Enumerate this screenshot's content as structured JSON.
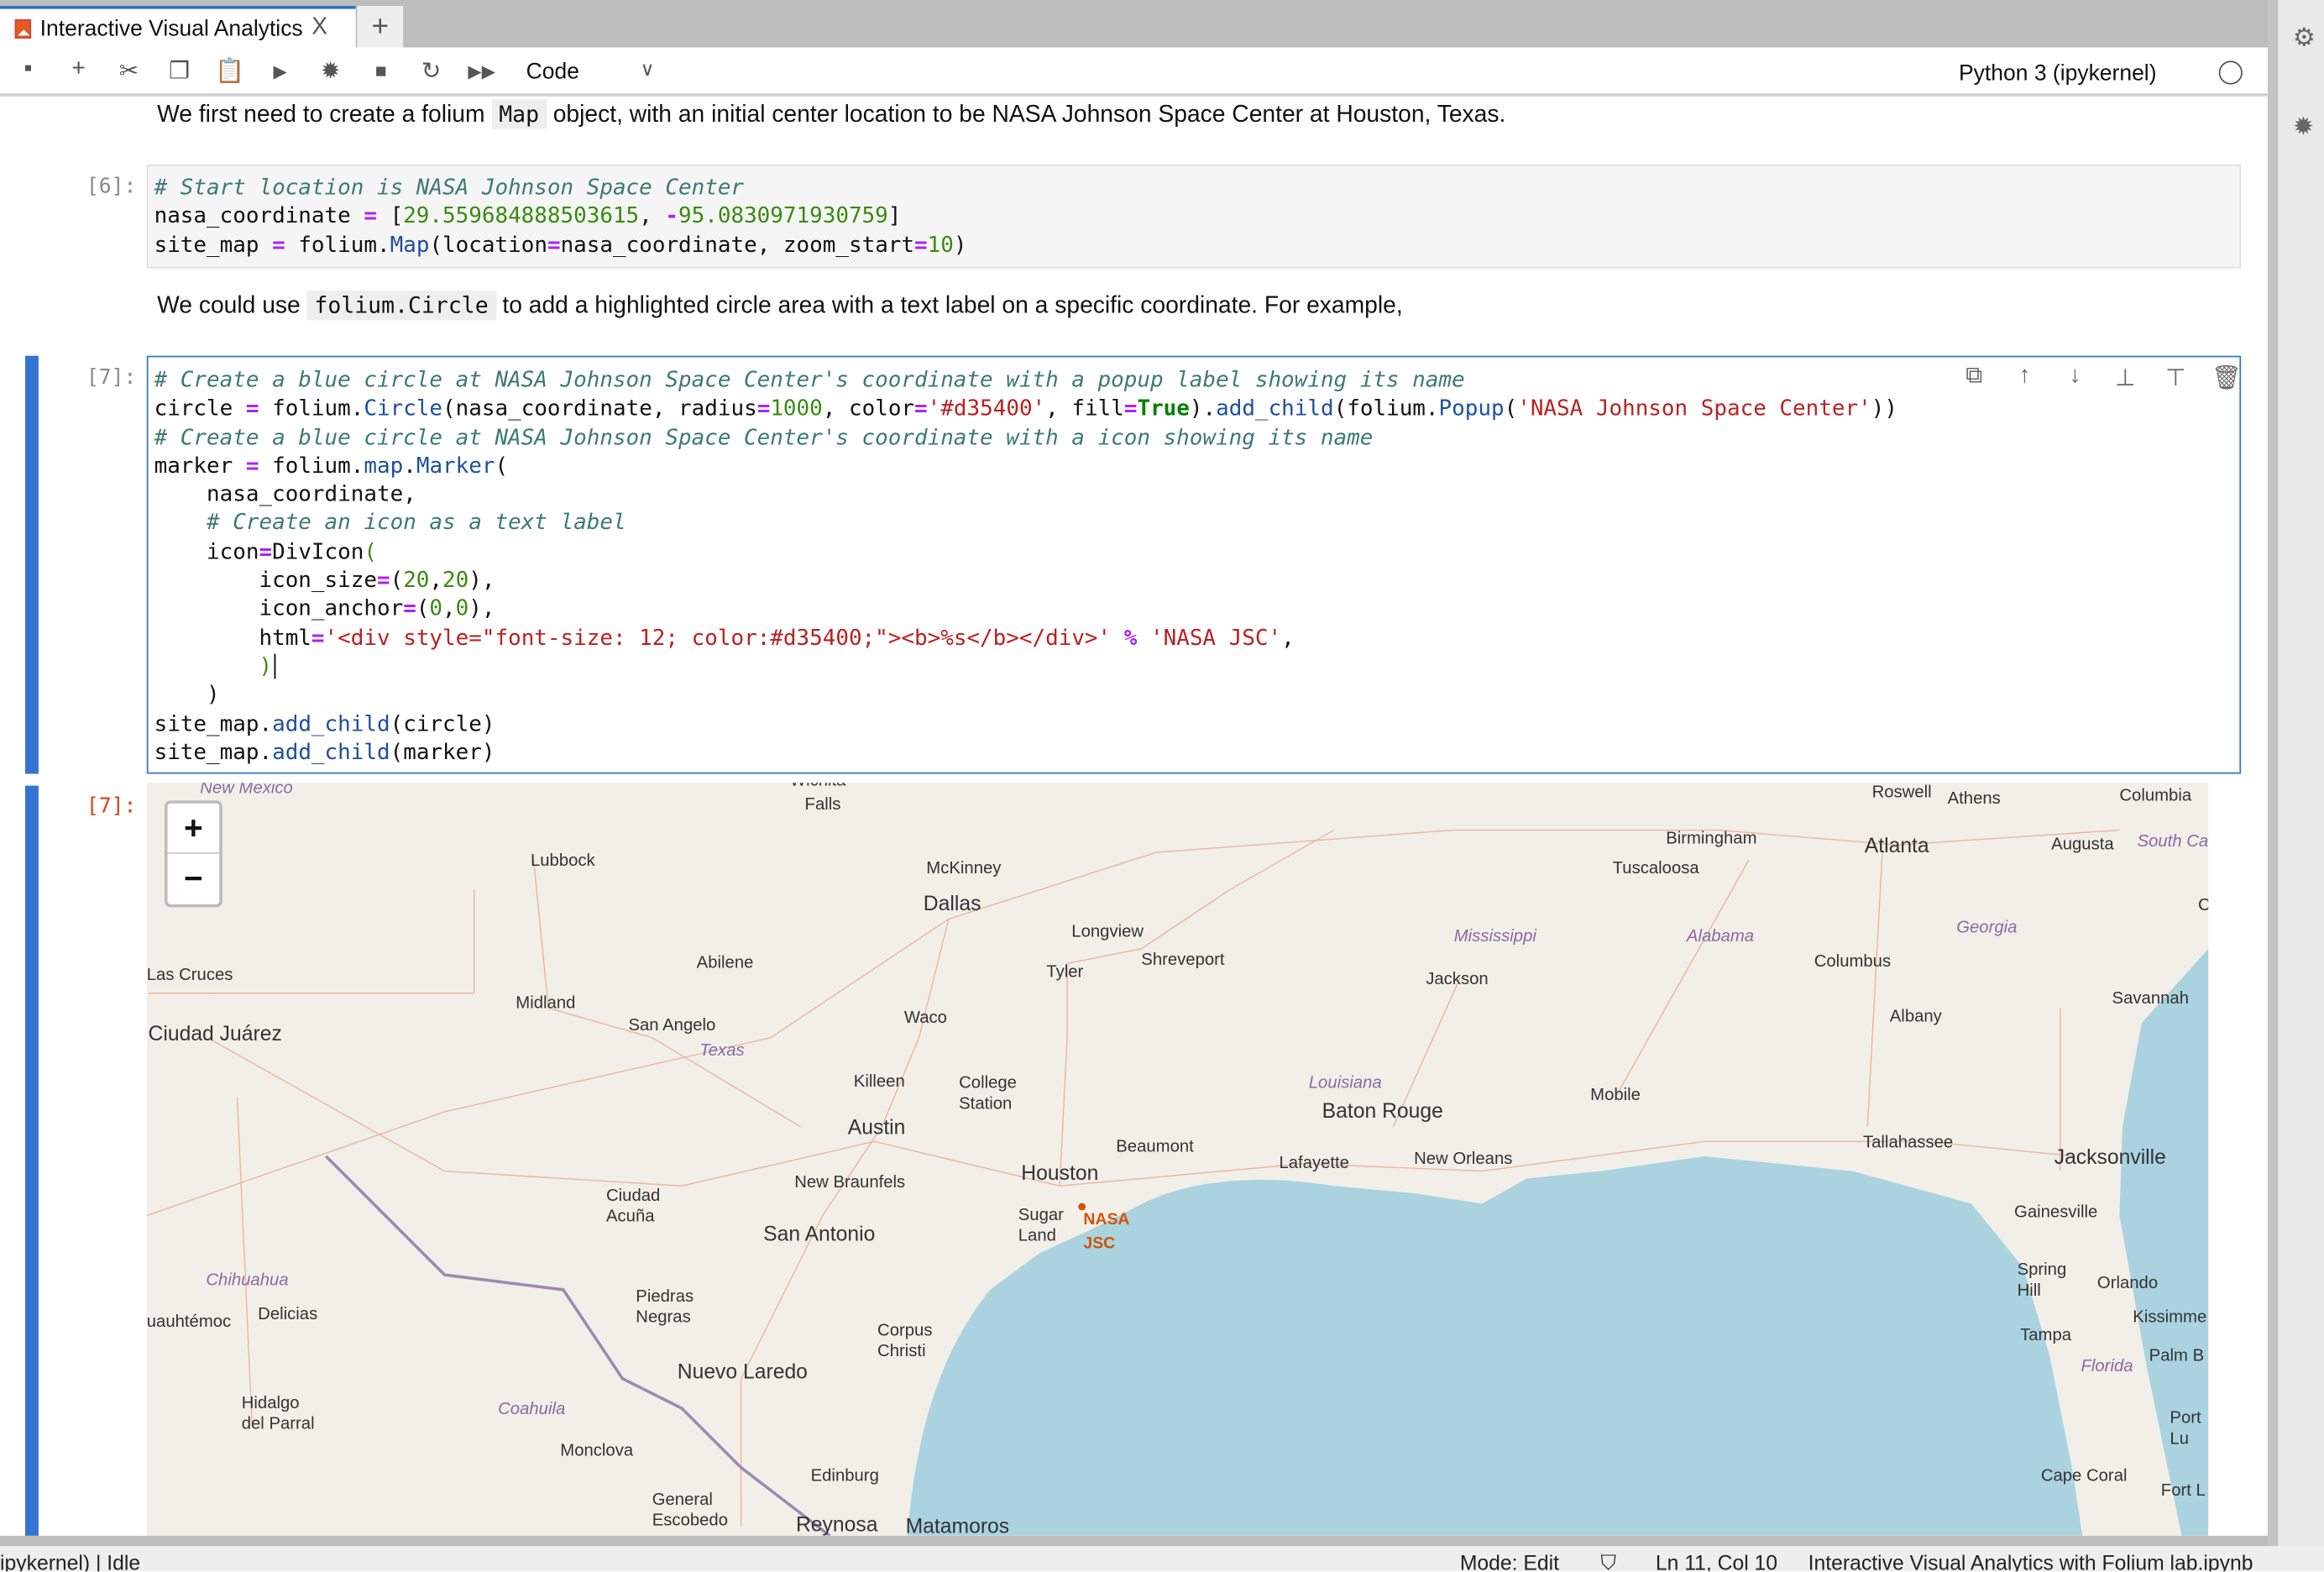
{
  "tab": {
    "title": "Interactive Visual Analytics",
    "close": "X",
    "new_tab": "+"
  },
  "toolbar": {
    "cell_type": "Code",
    "kernel": "Python 3 (ipykernel)",
    "icons": [
      "save-icon",
      "add-cell-icon",
      "cut-icon",
      "copy-icon",
      "paste-icon",
      "run-icon",
      "debug-icon",
      "stop-icon",
      "restart-icon",
      "run-all-icon"
    ]
  },
  "sidebar": {
    "icons": [
      "property-inspector-icon",
      "debugger-icon"
    ]
  },
  "notebook": {
    "md1": {
      "before": "We first need to create a folium ",
      "code": "Map",
      "after": " object, with an initial center location to be NASA Johnson Space Center at Houston, Texas."
    },
    "cell6": {
      "prompt": "[6]:",
      "lines": [
        [
          [
            "c",
            "# Start location is NASA Johnson Space Center"
          ]
        ],
        [
          [
            "n",
            "nasa_coordinate "
          ],
          [
            "o",
            "="
          ],
          [
            "n",
            " ["
          ],
          [
            "num",
            "29.559684888503615"
          ],
          [
            "n",
            ", "
          ],
          [
            "o",
            "-"
          ],
          [
            "num",
            "95.0830971930759"
          ],
          [
            "n",
            "]"
          ]
        ],
        [
          [
            "n",
            "site_map "
          ],
          [
            "o",
            "="
          ],
          [
            "n",
            " folium."
          ],
          [
            "f",
            "Map"
          ],
          [
            "n",
            "(location"
          ],
          [
            "o",
            "="
          ],
          [
            "n",
            "nasa_coordinate, zoom_start"
          ],
          [
            "o",
            "="
          ],
          [
            "num",
            "10"
          ],
          [
            "n",
            ")"
          ]
        ]
      ]
    },
    "md2": {
      "before": "We could use ",
      "code": "folium.Circle",
      "after": " to add a highlighted circle area with a text label on a specific coordinate. For example,"
    },
    "cell7": {
      "prompt": "[7]:",
      "output_prompt": "[7]:",
      "lines": [
        [
          [
            "c",
            "# Create a blue circle at NASA Johnson Space Center's coordinate with a popup label showing its name"
          ]
        ],
        [
          [
            "n",
            "circle "
          ],
          [
            "o",
            "="
          ],
          [
            "n",
            " folium."
          ],
          [
            "f",
            "Circle"
          ],
          [
            "n",
            "(nasa_coordinate, radius"
          ],
          [
            "o",
            "="
          ],
          [
            "num",
            "1000"
          ],
          [
            "n",
            ", color"
          ],
          [
            "o",
            "="
          ],
          [
            "s",
            "'#d35400'"
          ],
          [
            "n",
            ", fill"
          ],
          [
            "o",
            "="
          ],
          [
            "k",
            "True"
          ],
          [
            "n",
            ")."
          ],
          [
            "f",
            "add_child"
          ],
          [
            "n",
            "(folium."
          ],
          [
            "f",
            "Popup"
          ],
          [
            "n",
            "("
          ],
          [
            "s",
            "'NASA Johnson Space Center'"
          ],
          [
            "n",
            "))"
          ]
        ],
        [
          [
            "c",
            "# Create a blue circle at NASA Johnson Space Center's coordinate with a icon showing its name"
          ]
        ],
        [
          [
            "n",
            "marker "
          ],
          [
            "o",
            "="
          ],
          [
            "n",
            " folium."
          ],
          [
            "f",
            "map"
          ],
          [
            "n",
            "."
          ],
          [
            "f",
            "Marker"
          ],
          [
            "n",
            "("
          ]
        ],
        [
          [
            "n",
            "    nasa_coordinate,"
          ]
        ],
        [
          [
            "n",
            "    "
          ],
          [
            "c",
            "# Create an icon as a text label"
          ]
        ],
        [
          [
            "n",
            "    icon"
          ],
          [
            "o",
            "="
          ],
          [
            "n",
            "DivIcon"
          ],
          [
            "br",
            "("
          ]
        ],
        [
          [
            "n",
            "        icon_size"
          ],
          [
            "o",
            "="
          ],
          [
            "n",
            "("
          ],
          [
            "num",
            "20"
          ],
          [
            "n",
            ","
          ],
          [
            "num",
            "20"
          ],
          [
            "n",
            "),"
          ]
        ],
        [
          [
            "n",
            "        icon_anchor"
          ],
          [
            "o",
            "="
          ],
          [
            "n",
            "("
          ],
          [
            "num",
            "0"
          ],
          [
            "n",
            ","
          ],
          [
            "num",
            "0"
          ],
          [
            "n",
            "),"
          ]
        ],
        [
          [
            "n",
            "        html"
          ],
          [
            "o",
            "="
          ],
          [
            "s",
            "'<div style=\"font-size: 12; color:#d35400;\"><b>%s</b></div>'"
          ],
          [
            "n",
            " "
          ],
          [
            "o",
            "%"
          ],
          [
            "n",
            " "
          ],
          [
            "s",
            "'NASA JSC'"
          ],
          [
            "n",
            ","
          ]
        ],
        [
          [
            "n",
            "        "
          ],
          [
            "br",
            ")"
          ],
          [
            "cur",
            ""
          ]
        ],
        [
          [
            "n",
            "    )"
          ]
        ],
        [
          [
            "n",
            "site_map."
          ],
          [
            "f",
            "add_child"
          ],
          [
            "n",
            "(circle)"
          ]
        ],
        [
          [
            "n",
            "site_map."
          ],
          [
            "f",
            "add_child"
          ],
          [
            "n",
            "(marker)"
          ]
        ]
      ],
      "cell_toolbar": [
        "duplicate-icon",
        "move-up-icon",
        "move-down-icon",
        "insert-above-icon",
        "insert-below-icon",
        "delete-icon"
      ]
    }
  },
  "map": {
    "zoom_in": "+",
    "zoom_out": "−",
    "colors": {
      "land": "#f2efe9",
      "water": "#aad3df",
      "marker": "#d35400"
    },
    "marker_label": [
      "NASA",
      "JSC"
    ],
    "labels": [
      [
        "New Mexico"
      ],
      [
        "Wichita"
      ],
      [
        "Falls"
      ],
      [
        "Lubbock"
      ],
      [
        "McKinney"
      ],
      [
        "Dallas"
      ],
      [
        "Abilene"
      ],
      [
        "Longview"
      ],
      [
        "Shreveport"
      ],
      [
        "Tyler"
      ],
      [
        "Las Cruces"
      ],
      [
        "Midland"
      ],
      [
        "San Angelo"
      ],
      [
        "Texas"
      ],
      [
        "Waco"
      ],
      [
        "Ciudad Juárez"
      ],
      [
        "Killeen"
      ],
      [
        "College",
        "Station"
      ],
      [
        "Austin"
      ],
      [
        "Beaumont"
      ],
      [
        "Lafayette"
      ],
      [
        "Baton Rouge"
      ],
      [
        "Louisiana"
      ],
      [
        "New Orleans"
      ],
      [
        "Mississippi"
      ],
      [
        "Jackson"
      ],
      [
        "Birmingham"
      ],
      [
        "Tuscaloosa"
      ],
      [
        "Atlanta"
      ],
      [
        "Roswell"
      ],
      [
        "Athens"
      ],
      [
        "Columbia"
      ],
      [
        "Augusta"
      ],
      [
        "South Car"
      ],
      [
        "Alabama"
      ],
      [
        "Georgia"
      ],
      [
        "Columbus"
      ],
      [
        "Savannah"
      ],
      [
        "Albany"
      ],
      [
        "Mobile"
      ],
      [
        "Tallahassee"
      ],
      [
        "Jacksonville"
      ],
      [
        "Gainesville"
      ],
      [
        "Houston"
      ],
      [
        "New Braunfels"
      ],
      [
        "San Antonio"
      ],
      [
        "Ciudad",
        "Acuña"
      ],
      [
        "Sugar",
        "Land"
      ],
      [
        "Chihuahua"
      ],
      [
        "Delicias"
      ],
      [
        "uauhtémoc"
      ],
      [
        "Piedras",
        "Negras"
      ],
      [
        "Corpus",
        "Christi"
      ],
      [
        "Spring",
        "Hill"
      ],
      [
        "Orlando"
      ],
      [
        "Kissimme"
      ],
      [
        "Tampa"
      ],
      [
        "Florida"
      ],
      [
        "Palm B"
      ],
      [
        "Hidalgo",
        "del Parral"
      ],
      [
        "Coahuila"
      ],
      [
        "Nuevo Laredo"
      ],
      [
        "Monclova"
      ],
      [
        "Port",
        "Lu"
      ],
      [
        "Cape Coral"
      ],
      [
        "Fort L"
      ],
      [
        "Edinburg"
      ],
      [
        "General",
        "Escobedo"
      ],
      [
        "Reynosa"
      ],
      [
        "Matamoros"
      ],
      [
        "C"
      ]
    ]
  },
  "status": {
    "left": "ipykernel) | Idle",
    "mode": "Mode: Edit",
    "position": "Ln 11, Col 10",
    "file": "Interactive Visual Analytics with Folium lab.ipynb"
  }
}
